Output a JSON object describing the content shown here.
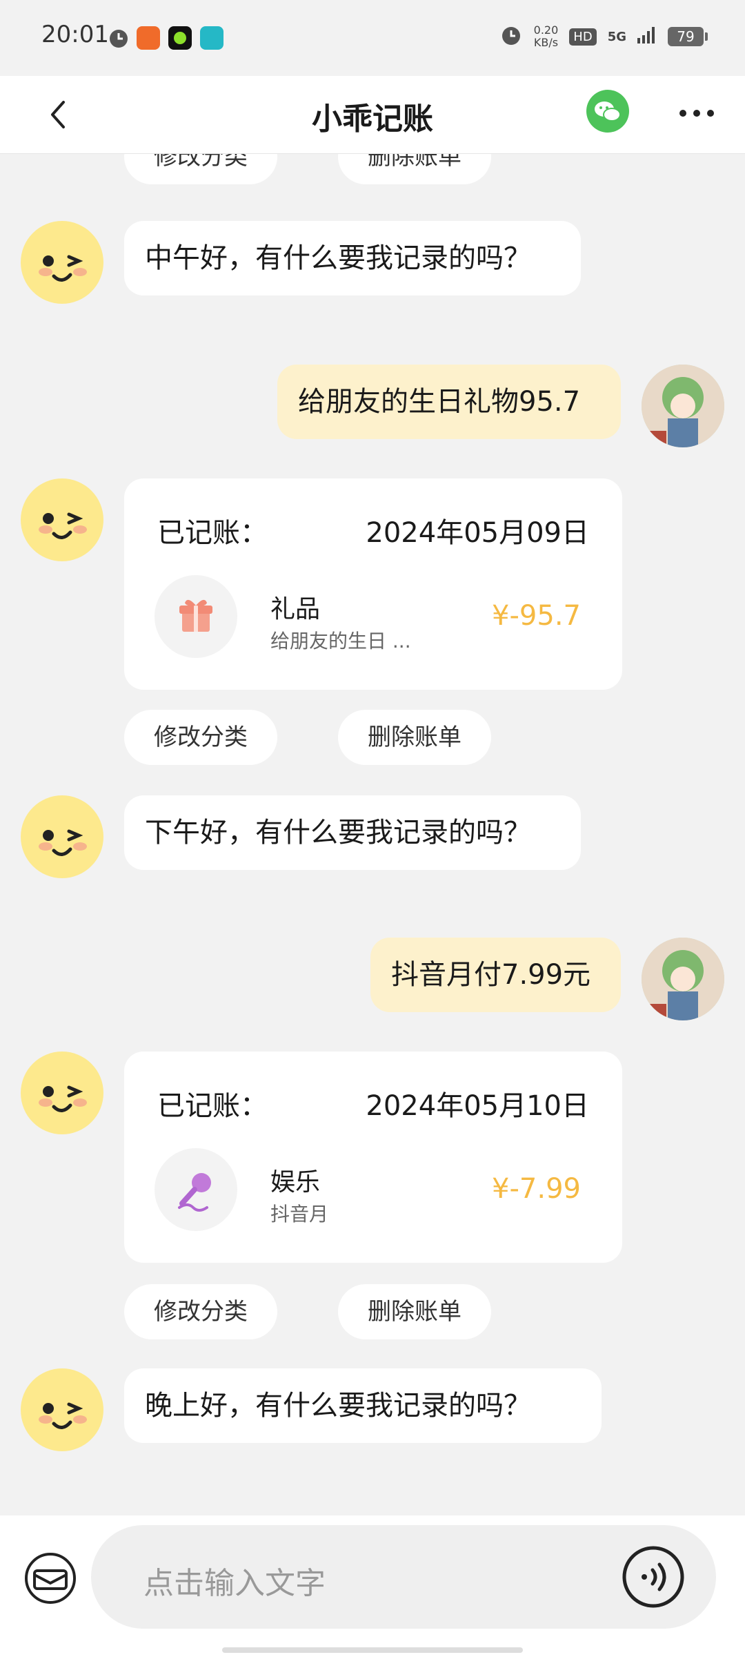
{
  "status_bar": {
    "time": "20:01",
    "speed_value": "0.20",
    "speed_unit": "KB/s",
    "hd": "HD",
    "network": "5G",
    "battery": "79"
  },
  "header": {
    "title": "小乖记账",
    "icons": {
      "back": "chevron-left-icon",
      "share": "wechat-icon",
      "menu": "more-dots-icon"
    }
  },
  "chat": {
    "actions": {
      "edit_category": "修改分类",
      "delete_bill": "删除账单"
    },
    "bot_greeting_noon": "中午好，有什么要我记录的吗？",
    "user_msg_1": "给朋友的生日礼物95.7",
    "record_1": {
      "label": "已记账：",
      "date": "2024年05月09日",
      "category": "礼品",
      "note": "给朋友的生日 ...",
      "amount": "¥-95.7",
      "icon": "gift-icon"
    },
    "bot_greeting_afternoon": "下午好，有什么要我记录的吗？",
    "user_msg_2": "抖音月付7.99元",
    "record_2": {
      "label": "已记账：",
      "date": "2024年05月10日",
      "category": "娱乐",
      "note": "抖音月",
      "amount": "¥-7.99",
      "icon": "microphone-icon"
    },
    "bot_greeting_evening": "晚上好，有什么要我记录的吗？"
  },
  "input": {
    "placeholder": "点击输入文字",
    "icons": {
      "left": "wallet-icon",
      "right": "voice-icon"
    }
  },
  "colors": {
    "bot_bubble": "#ffffff",
    "user_bubble": "#fdf1cc",
    "amount": "#f5b942",
    "background": "#f2f2f2",
    "wechat": "#4dc35a"
  }
}
